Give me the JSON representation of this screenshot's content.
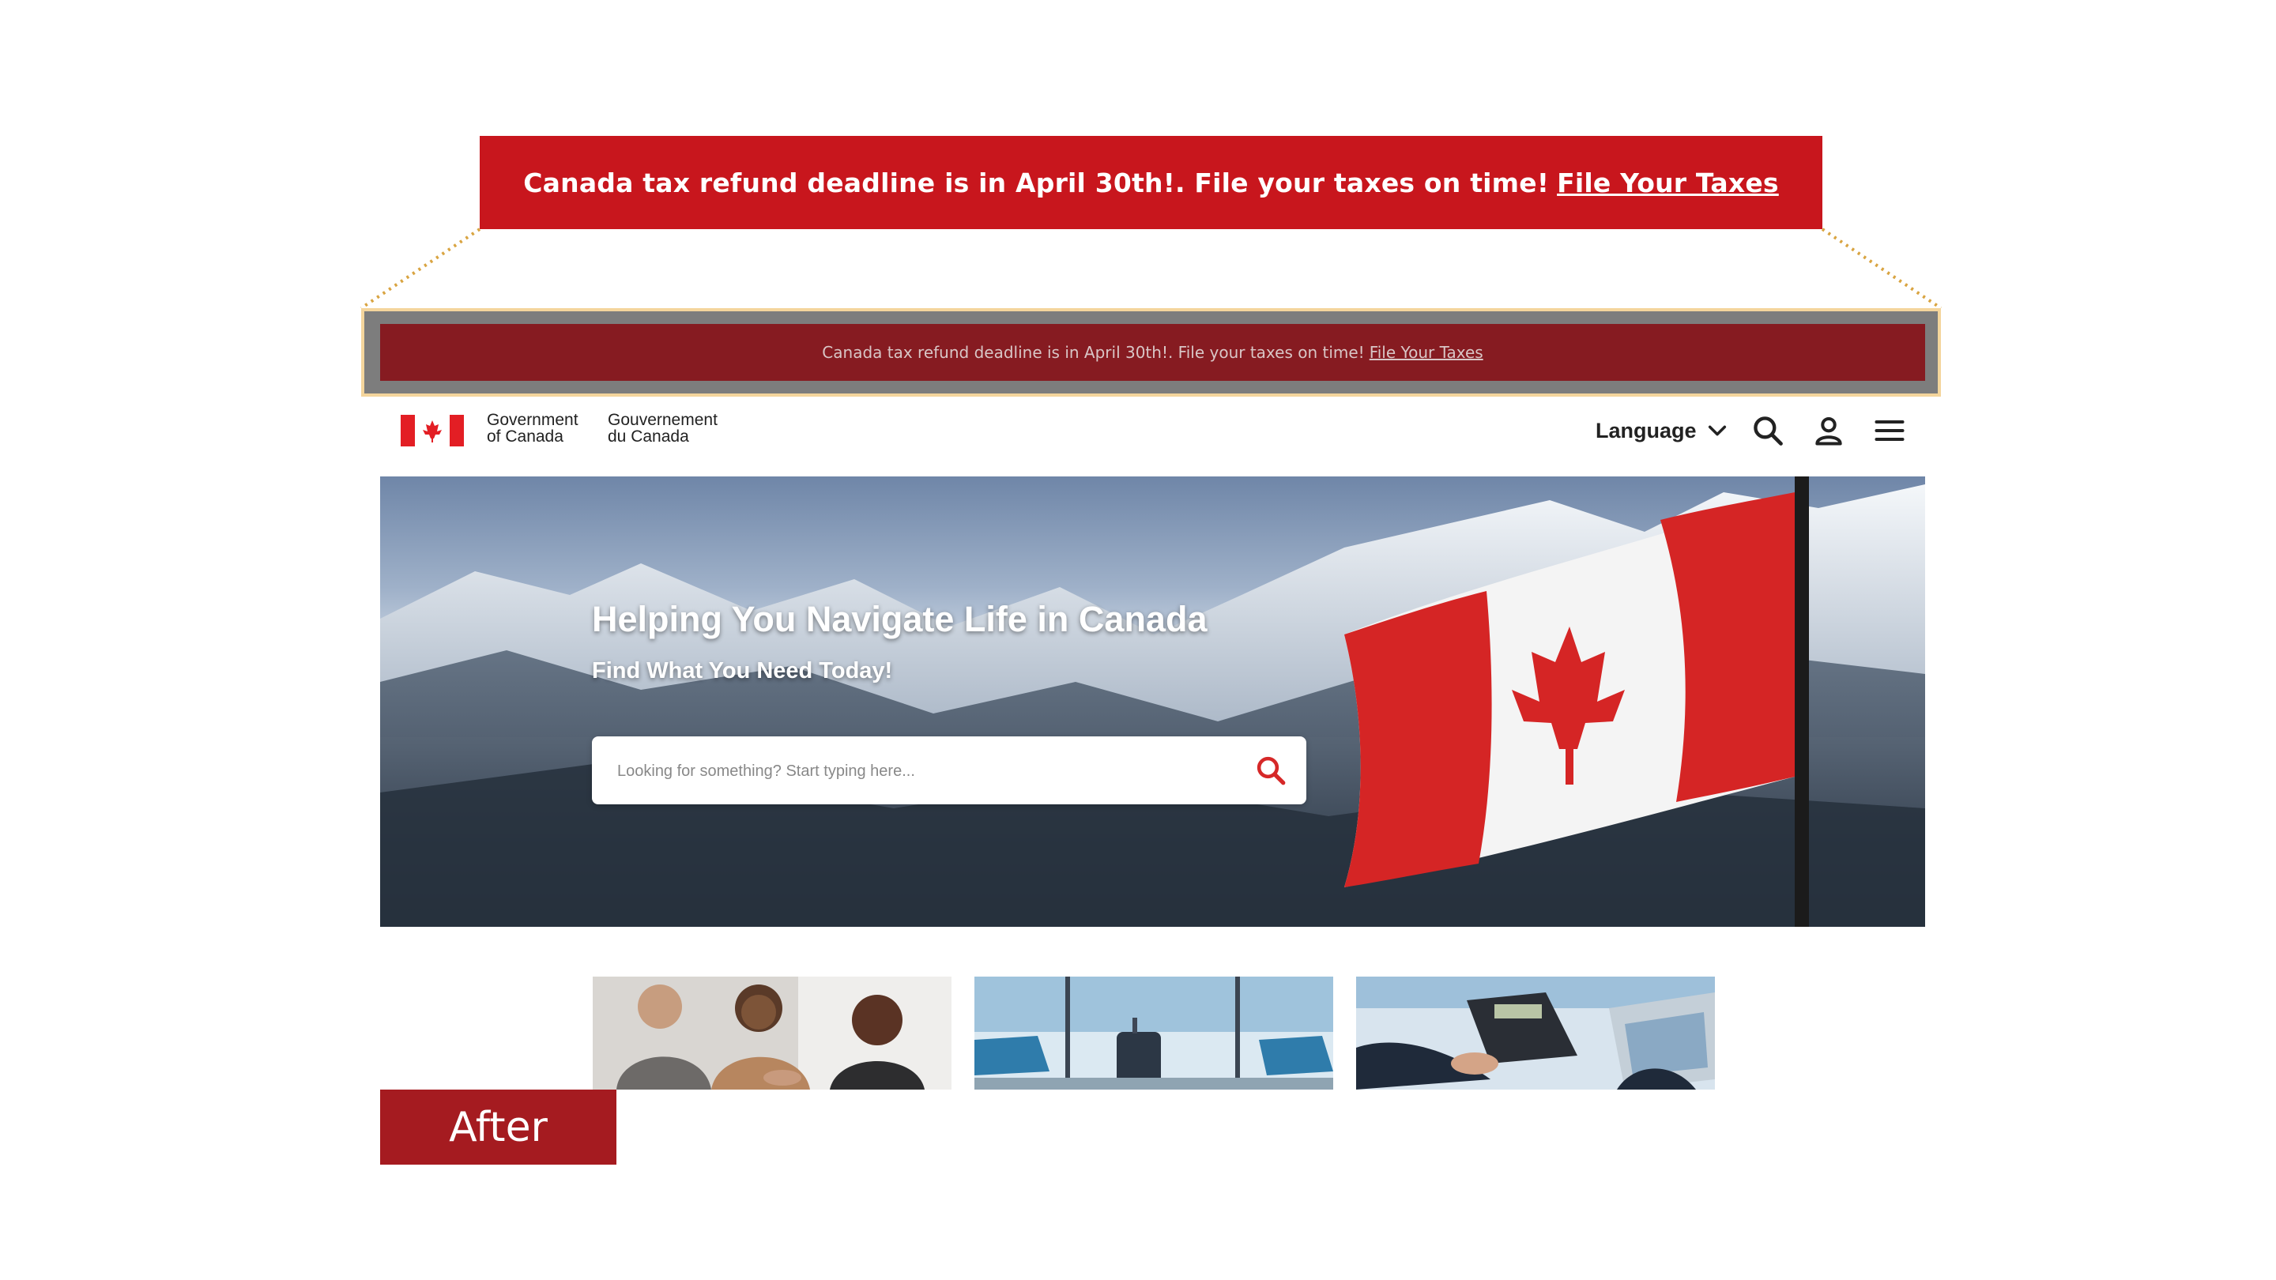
{
  "callout": {
    "message": "Canada tax refund deadline is in April 30th!. File your taxes on time!",
    "link_label": "File Your Taxes",
    "color": "#c8161d"
  },
  "alert_banner": {
    "message": "Canada tax refund deadline is in April 30th!. File your taxes on time!",
    "link_label": "File Your Taxes",
    "color": "#861b21",
    "highlight_color": "#f4d59c"
  },
  "header": {
    "logo_icon": "canada-flag-icon",
    "wordmark_en_line1": "Government",
    "wordmark_en_line2": "of Canada",
    "wordmark_fr_line1": "Gouvernement",
    "wordmark_fr_line2": "du Canada",
    "language_label": "Language",
    "icons": [
      "chevron-down-icon",
      "search-icon",
      "user-icon",
      "menu-icon"
    ]
  },
  "hero": {
    "title": "Helping You Navigate Life in Canada",
    "subtitle": "Find What You Need Today!",
    "search_placeholder": "Looking for something? Start typing here...",
    "accent": "#d62828"
  },
  "cards": [
    {
      "image": "people-meeting-handshake"
    },
    {
      "image": "airport-lounge-suitcase"
    },
    {
      "image": "calculator-laptop-finance"
    }
  ],
  "badge": {
    "label": "After",
    "color": "#a51b20"
  }
}
